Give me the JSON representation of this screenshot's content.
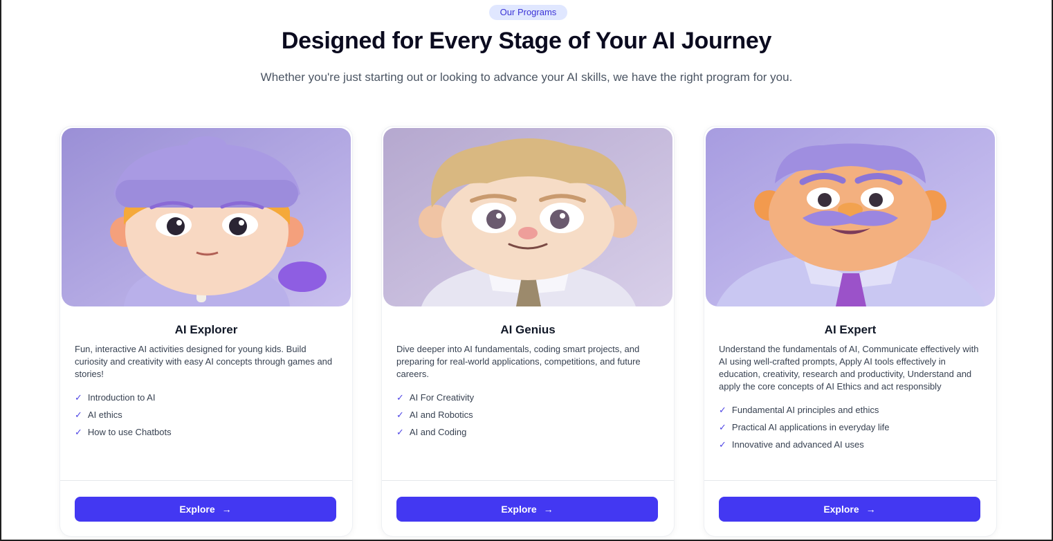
{
  "header": {
    "badge": "Our Programs",
    "title": "Designed for Every Stage of Your AI Journey",
    "subtitle": "Whether you're just starting out or looking to advance your AI skills, we have the right program for you."
  },
  "colors": {
    "accent": "#4338f2",
    "badge_bg": "#e0e7ff",
    "check": "#4f46e5"
  },
  "cards": [
    {
      "image_icon": "ai-explorer-avatar",
      "title": "AI Explorer",
      "description": "Fun, interactive AI activities designed for young kids. Build curiosity and creativity with easy AI concepts through games and stories!",
      "features": [
        "Introduction to AI",
        "AI ethics",
        "How to use Chatbots"
      ],
      "button": "Explore"
    },
    {
      "image_icon": "ai-genius-avatar",
      "title": "AI Genius",
      "description": "Dive deeper into AI fundamentals, coding smart projects, and preparing for real-world applications, competitions, and future careers.",
      "features": [
        "AI For Creativity",
        "AI and Robotics",
        "AI and Coding"
      ],
      "button": "Explore"
    },
    {
      "image_icon": "ai-expert-avatar",
      "title": "AI Expert",
      "description": "Understand the fundamentals of AI, Communicate effectively with AI using well-crafted prompts, Apply AI tools effectively in education, creativity, research and productivity, Understand and apply the core concepts of AI Ethics and act responsibly",
      "features": [
        "Fundamental AI principles and ethics",
        "Practical AI applications in everyday life",
        "Innovative and advanced AI uses"
      ],
      "button": "Explore"
    }
  ],
  "check_glyph": "✓",
  "arrow_glyph": "→"
}
